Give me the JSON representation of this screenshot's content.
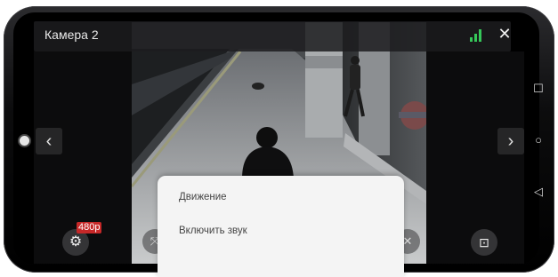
{
  "header": {
    "title": "Камера 2"
  },
  "player": {
    "quality_badge": "480p"
  },
  "menu": {
    "items": [
      {
        "label": "Движение"
      },
      {
        "label": "Включить звук"
      }
    ]
  },
  "icons": {
    "signal": "signal-strength-icon",
    "close": "close-icon",
    "prev": "chevron-left-icon",
    "next": "chevron-right-icon",
    "quality": "settings-gear-icon",
    "snapshot": "camera-snapshot-icon",
    "recents": "square-icon",
    "home": "circle-icon",
    "back": "triangle-back-icon"
  },
  "colors": {
    "signal": "#35c759",
    "badge": "#c62828",
    "sheet_bg": "#f4f4f4"
  }
}
